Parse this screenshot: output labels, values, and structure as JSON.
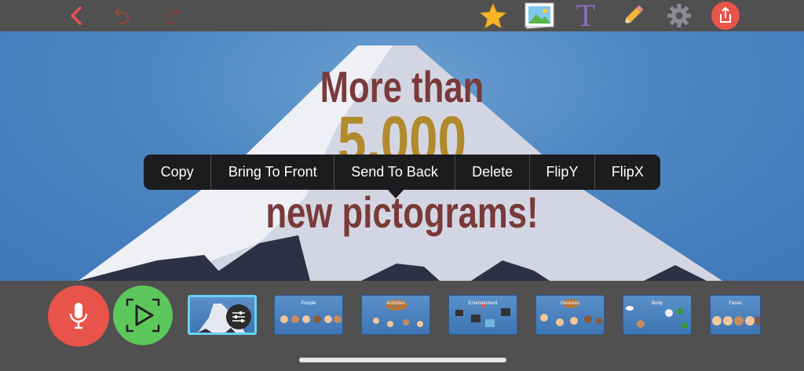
{
  "toolbar": {
    "back_icon": "chevron-left-icon",
    "undo_icon": "undo-icon",
    "redo_icon": "redo-icon",
    "favorites_icon": "star-icon",
    "image_icon": "image-icon",
    "text_icon_glyph": "T",
    "pencil_icon": "pencil-icon",
    "settings_icon": "gear-icon",
    "share_icon": "share-icon",
    "accent_color": "#e8534a"
  },
  "slide": {
    "line1": "More than",
    "line2": "5,000",
    "line3": "new pictograms!"
  },
  "context_menu": {
    "items": [
      "Copy",
      "Bring To Front",
      "Send To Back",
      "Delete",
      "FlipY",
      "FlipX"
    ]
  },
  "bottom": {
    "record_icon": "microphone-icon",
    "play_icon": "play-icon",
    "record_color": "#e8534a",
    "play_color": "#5cc85c",
    "thumbnails": [
      {
        "label": "",
        "selected": true
      },
      {
        "label": "People",
        "selected": false
      },
      {
        "label": "Activities",
        "selected": false
      },
      {
        "label": "Entertainment",
        "selected": false
      },
      {
        "label": "Gestures",
        "selected": false
      },
      {
        "label": "Body",
        "selected": false
      },
      {
        "label": "Faces",
        "selected": false
      }
    ]
  }
}
